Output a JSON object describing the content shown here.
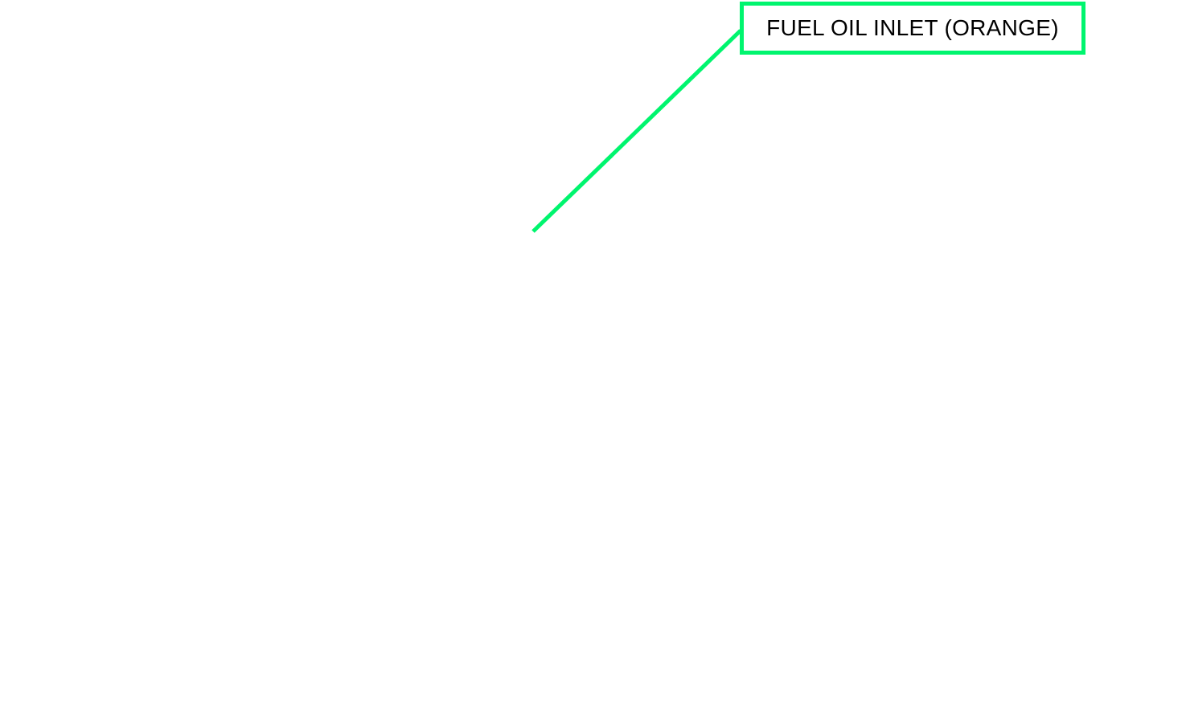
{
  "annotation": {
    "label": "FUEL OIL INLET (ORANGE)",
    "accent_color": "#00f56e",
    "text_color": "#000000",
    "background_color": "#ffffff"
  }
}
